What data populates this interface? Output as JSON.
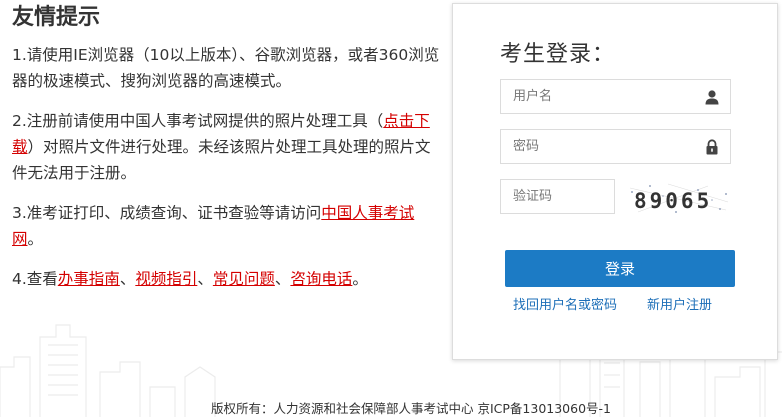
{
  "tips": {
    "title": "友情提示",
    "item1": "1.请使用IE浏览器（10以上版本）、谷歌浏览器，或者360浏览器的极速模式、搜狗浏览器的高速模式。",
    "item2_prefix": "2.注册前请使用中国人事考试网提供的照片处理工具（",
    "item2_link": "点击下载",
    "item2_suffix": "）对照片文件进行处理。未经该照片处理工具处理的照片文件无法用于注册。",
    "item3_prefix": "3.准考证打印、成绩查询、证书查验等请访问",
    "item3_link": "中国人事考试网",
    "item3_suffix": "。",
    "item4_prefix": "4.查看",
    "item4_links": [
      "办事指南",
      "视频指引",
      "常见问题",
      "咨询电话"
    ],
    "item4_sep": "、",
    "item4_suffix": "。"
  },
  "login": {
    "title": "考生登录：",
    "username_placeholder": "用户名",
    "password_placeholder": "密码",
    "captcha_placeholder": "验证码",
    "captcha_text": "89065",
    "submit_label": "登录",
    "find_account_link": "找回用户名或密码",
    "register_link": "新用户注册"
  },
  "footer": {
    "copyright": "版权所有：人力资源和社会保障部人事考试中心 京ICP备13013060号-1"
  },
  "colors": {
    "accent": "#1c7bc5",
    "link_red": "#d40000",
    "link_blue": "#1d6fb8"
  },
  "icons": [
    "user-icon",
    "lock-icon"
  ]
}
